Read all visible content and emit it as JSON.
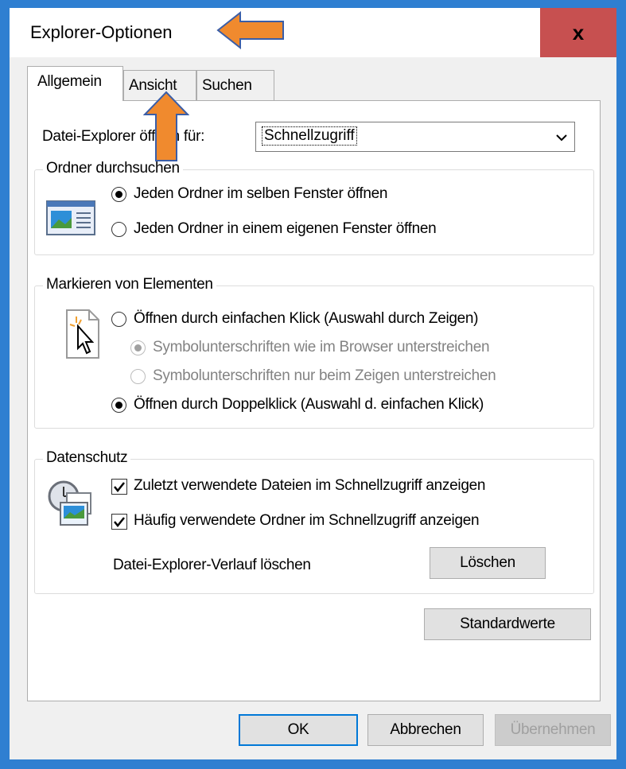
{
  "window": {
    "title": "Explorer-Optionen",
    "close_label": "x"
  },
  "tabs": [
    {
      "label": "Allgemein",
      "active": true
    },
    {
      "label": "Ansicht",
      "active": false
    },
    {
      "label": "Suchen",
      "active": false
    }
  ],
  "open_for": {
    "label": "Datei-Explorer öffnen für:",
    "value": "Schnellzugriff"
  },
  "browse_folders": {
    "title": "Ordner durchsuchen",
    "options": [
      {
        "label": "Jeden Ordner im selben Fenster öffnen",
        "checked": true
      },
      {
        "label": "Jeden Ordner in einem eigenen Fenster öffnen",
        "checked": false
      }
    ]
  },
  "click_items": {
    "title": "Markieren von Elementen",
    "single_click": "Öffnen durch einfachen Klick (Auswahl durch Zeigen)",
    "underline_browser": "Symbolunterschriften wie im Browser unterstreichen",
    "underline_hover": "Symbolunterschriften nur beim Zeigen unterstreichen",
    "double_click": "Öffnen durch Doppelklick (Auswahl d. einfachen Klick)"
  },
  "privacy": {
    "title": "Datenschutz",
    "recent_files": "Zuletzt verwendete Dateien im Schnellzugriff anzeigen",
    "frequent_folders": "Häufig verwendete Ordner im Schnellzugriff anzeigen",
    "clear_history_label": "Datei-Explorer-Verlauf löschen",
    "clear_button": "Löschen"
  },
  "restore_defaults_button": "Standardwerte",
  "footer": {
    "ok": "OK",
    "cancel": "Abbrechen",
    "apply": "Übernehmen"
  },
  "colors": {
    "frame": "#2f7fd1",
    "close": "#c75050",
    "annotation_arrow": "#f08a2e"
  }
}
